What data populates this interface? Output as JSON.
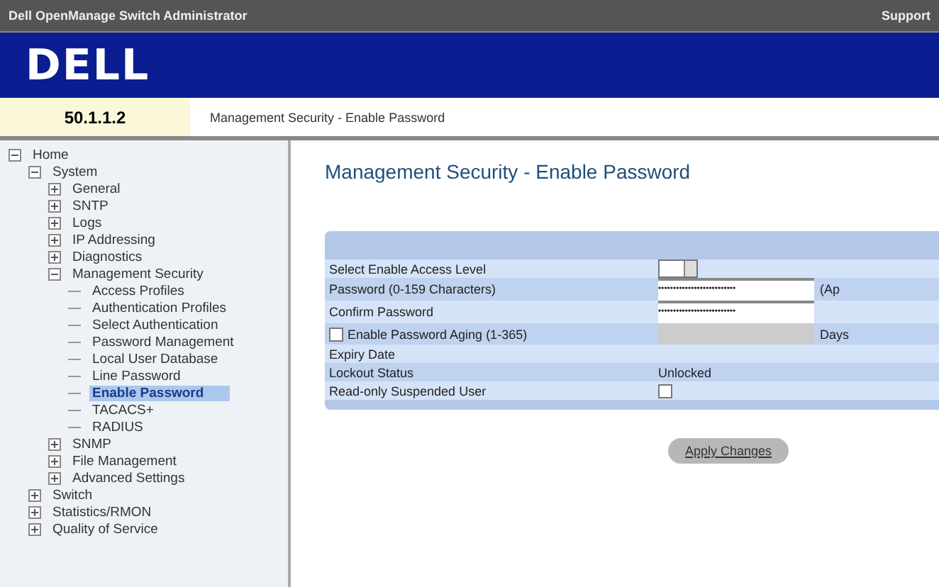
{
  "window": {
    "title": "Dell OpenManage Switch Administrator",
    "support_link": "Support"
  },
  "header": {
    "logo": "DELL",
    "ip_address": "50.1.1.2",
    "breadcrumb": "Management Security - Enable Password"
  },
  "sidebar": {
    "items": [
      {
        "label": "Home",
        "expanded": true,
        "selected": false,
        "children": [
          {
            "label": "System",
            "expanded": true,
            "selected": false,
            "children": [
              {
                "label": "General",
                "expanded": false,
                "selected": false
              },
              {
                "label": "SNTP",
                "expanded": false,
                "selected": false
              },
              {
                "label": "Logs",
                "expanded": false,
                "selected": false
              },
              {
                "label": "IP Addressing",
                "expanded": false,
                "selected": false
              },
              {
                "label": "Diagnostics",
                "expanded": false,
                "selected": false
              },
              {
                "label": "Management Security",
                "expanded": true,
                "selected": false,
                "children": [
                  {
                    "label": "Access Profiles",
                    "selected": false
                  },
                  {
                    "label": "Authentication Profiles",
                    "selected": false
                  },
                  {
                    "label": "Select Authentication",
                    "selected": false
                  },
                  {
                    "label": "Password Management",
                    "selected": false
                  },
                  {
                    "label": "Local User Database",
                    "selected": false
                  },
                  {
                    "label": "Line Password",
                    "selected": false
                  },
                  {
                    "label": "Enable Password",
                    "selected": true
                  },
                  {
                    "label": "TACACS+",
                    "selected": false
                  },
                  {
                    "label": "RADIUS",
                    "selected": false
                  }
                ]
              },
              {
                "label": "SNMP",
                "expanded": false,
                "selected": false
              },
              {
                "label": "File Management",
                "expanded": false,
                "selected": false
              },
              {
                "label": "Advanced Settings",
                "expanded": false,
                "selected": false
              }
            ]
          },
          {
            "label": "Switch",
            "expanded": false,
            "selected": false
          },
          {
            "label": "Statistics/RMON",
            "expanded": false,
            "selected": false
          },
          {
            "label": "Quality of Service",
            "expanded": false,
            "selected": false
          }
        ]
      }
    ]
  },
  "page": {
    "title": "Management Security - Enable Password",
    "rows": [
      {
        "kind": "select",
        "label": "Select Enable Access Level"
      },
      {
        "kind": "password",
        "label": "Password (0-159 Characters)",
        "value": "••••••••••••••••••••••••••",
        "note": "(Ap"
      },
      {
        "kind": "password",
        "label": "Confirm Password",
        "value": "••••••••••••••••••••••••••"
      },
      {
        "kind": "aging",
        "label": "Enable Password Aging (1-365)",
        "checked": false,
        "note": "Days"
      },
      {
        "kind": "text",
        "label": "Expiry Date"
      },
      {
        "kind": "text",
        "label": "Lockout Status",
        "value": "Unlocked"
      },
      {
        "kind": "checkbox",
        "label": "Read-only Suspended User",
        "checked": false
      }
    ],
    "button": "Apply Changes"
  }
}
